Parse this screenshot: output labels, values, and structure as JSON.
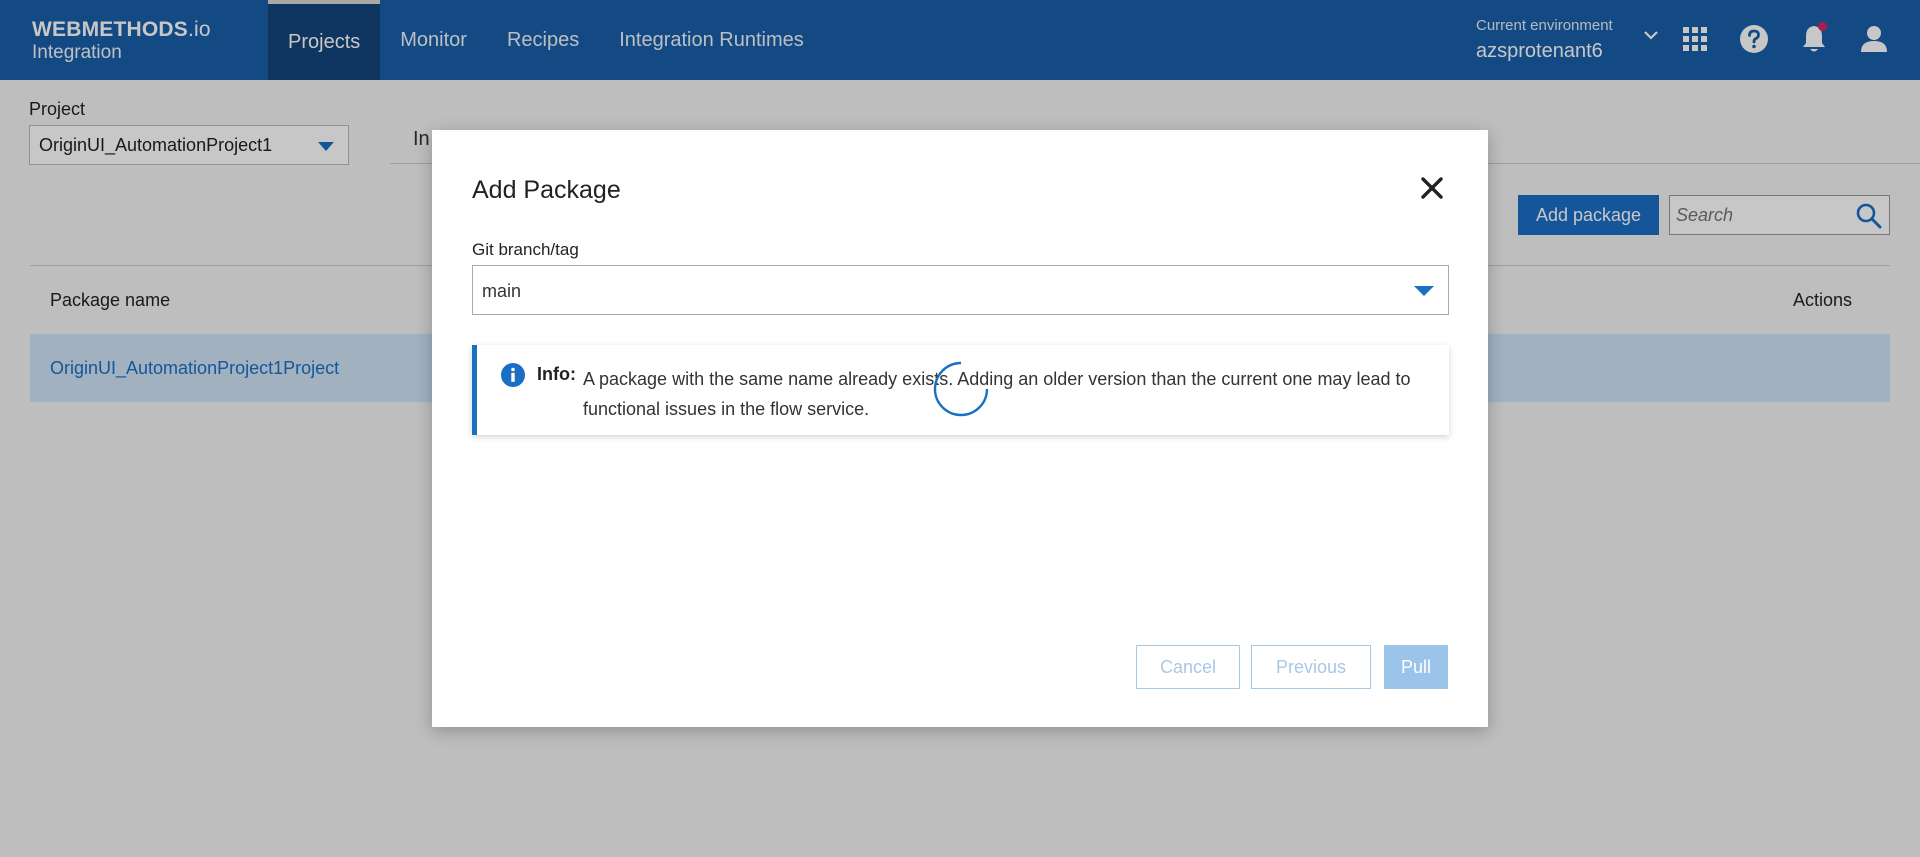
{
  "header": {
    "brand_main": "WEBMETHODS",
    "brand_suffix": ".io",
    "brand_sub": "Integration",
    "nav": [
      "Projects",
      "Monitor",
      "Recipes",
      "Integration Runtimes"
    ],
    "active_nav": "Projects",
    "env_label": "Current environment",
    "env_value": "azsprotenant6",
    "icons": [
      "apps-grid-icon",
      "help-icon",
      "bell-icon",
      "user-icon"
    ],
    "accent": "#1a5fa8"
  },
  "page": {
    "project_label": "Project",
    "project_value": "OriginUI_AutomationProject1",
    "tab_partial": "In",
    "add_package_label": "Add package",
    "search_placeholder": "Search",
    "columns": {
      "package_name": "Package name",
      "actions": "Actions"
    },
    "rows": [
      {
        "name": "OriginUI_AutomationProject1Project"
      }
    ]
  },
  "modal": {
    "title": "Add Package",
    "branch_label": "Git branch/tag",
    "branch_value": "main",
    "info_tag": "Info:",
    "info_text": "A package with the same name already exists. Adding an older version than the current one may lead to functional issues in the flow service.",
    "cancel_label": "Cancel",
    "previous_label": "Previous",
    "pull_label": "Pull"
  }
}
